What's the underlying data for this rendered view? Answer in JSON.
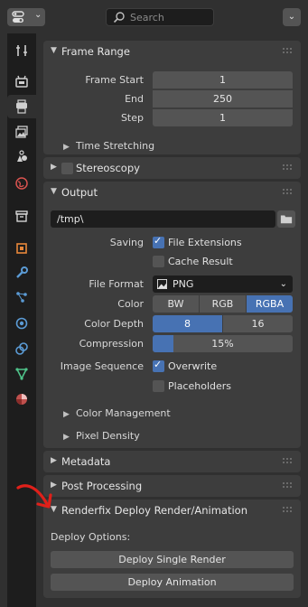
{
  "header": {
    "search_placeholder": "Search"
  },
  "tabs": [
    "tool-icon",
    "render-icon",
    "output-icon",
    "view-layer-icon",
    "scene-icon",
    "world-icon",
    "collection-icon",
    "object-icon",
    "modifier-icon",
    "particles-icon",
    "physics-icon",
    "constraints-icon",
    "data-icon",
    "material-icon"
  ],
  "frame_range": {
    "title": "Frame Range",
    "rows": [
      {
        "label": "Frame Start",
        "value": "1"
      },
      {
        "label": "End",
        "value": "250"
      },
      {
        "label": "Step",
        "value": "1"
      }
    ],
    "time_stretching": "Time Stretching"
  },
  "stereoscopy": {
    "title": "Stereoscopy"
  },
  "output": {
    "title": "Output",
    "path": "/tmp\\",
    "saving_label": "Saving",
    "file_extensions": "File Extensions",
    "cache_result": "Cache Result",
    "file_format_label": "File Format",
    "file_format": "PNG",
    "color_label": "Color",
    "color_options": [
      "BW",
      "RGB",
      "RGBA"
    ],
    "color_selected": "RGBA",
    "color_depth_label": "Color Depth",
    "color_depth_options": [
      "8",
      "16"
    ],
    "color_depth_selected": "8",
    "compression_label": "Compression",
    "compression": "15%",
    "compression_value": 0.15,
    "image_sequence_label": "Image Sequence",
    "overwrite": "Overwrite",
    "placeholders": "Placeholders",
    "color_management": "Color Management",
    "pixel_density": "Pixel Density"
  },
  "metadata": {
    "title": "Metadata"
  },
  "post_processing": {
    "title": "Post Processing"
  },
  "renderfix": {
    "title": "Renderfix Deploy Render/Animation",
    "deploy_options": "Deploy Options:",
    "deploy_single": "Deploy Single Render",
    "deploy_animation": "Deploy Animation"
  },
  "colors": {
    "accent": "#4772b3",
    "arrow": "#e0201a"
  }
}
